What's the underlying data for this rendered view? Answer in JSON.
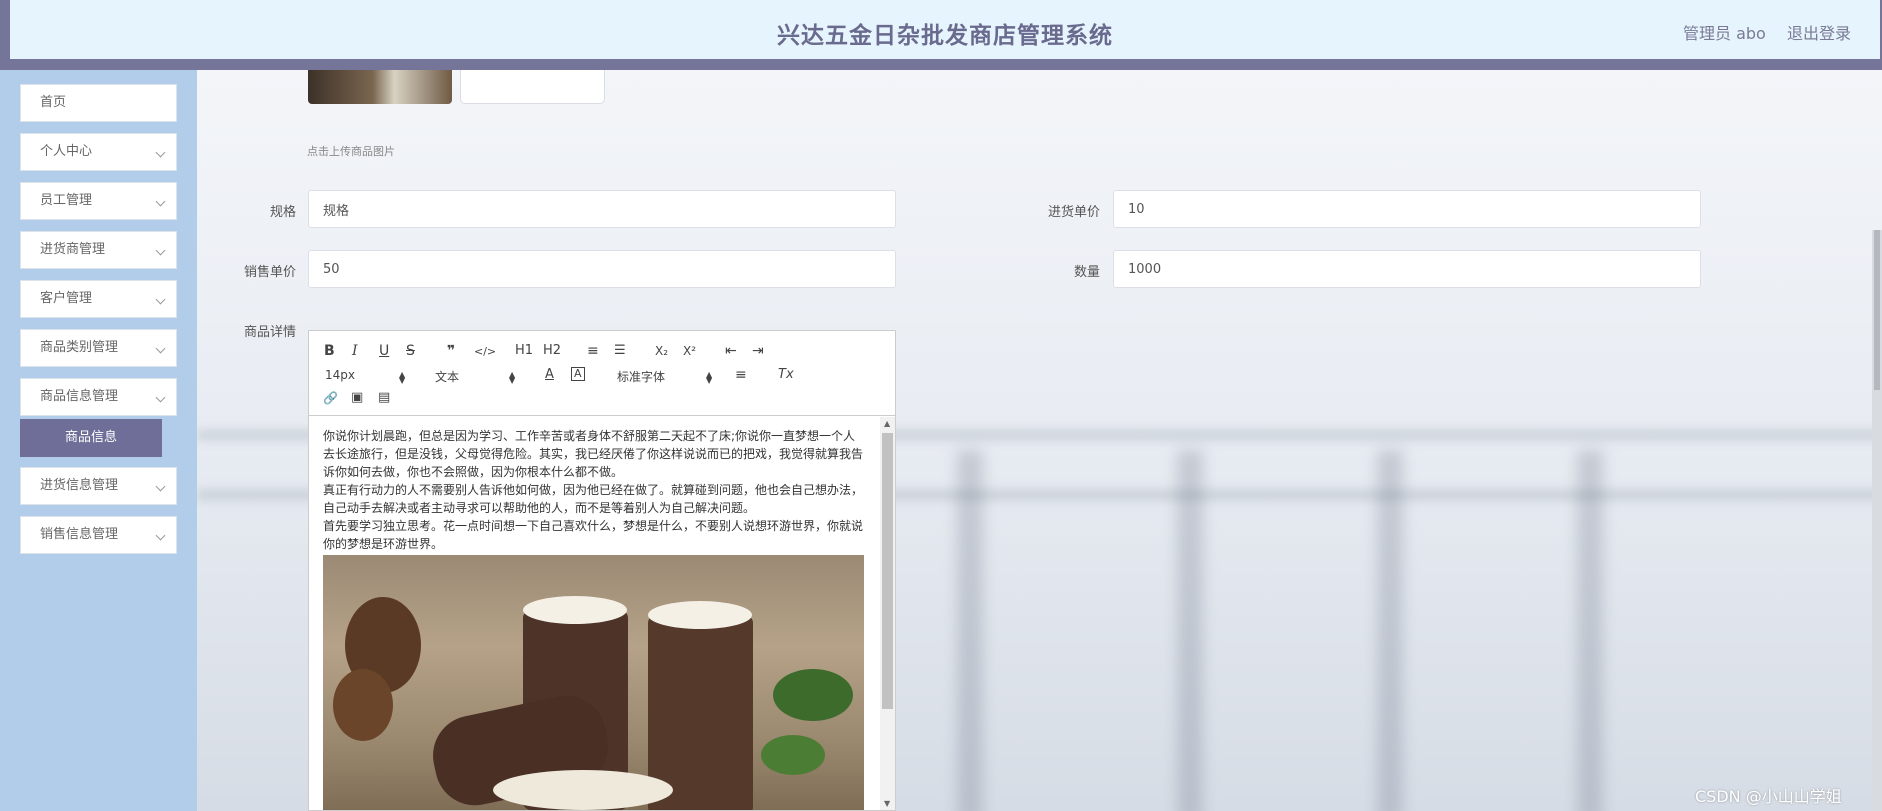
{
  "header": {
    "title": "兴达五金日杂批发商店管理系统",
    "admin": "管理员 abo",
    "logout": "退出登录"
  },
  "sidebar": {
    "items": [
      {
        "label": "首页"
      },
      {
        "label": "个人中心"
      },
      {
        "label": "员工管理"
      },
      {
        "label": "进货商管理"
      },
      {
        "label": "客户管理"
      },
      {
        "label": "商品类别管理"
      },
      {
        "label": "商品信息管理"
      },
      {
        "label": "进货信息管理"
      },
      {
        "label": "销售信息管理"
      }
    ],
    "active_sub": "商品信息"
  },
  "form": {
    "upload_hint": "点击上传商品图片",
    "spec_label": "规格",
    "spec_value": "规格",
    "purchase_price_label": "进货单价",
    "purchase_price_value": "10",
    "sale_price_label": "销售单价",
    "sale_price_value": "50",
    "quantity_label": "数量",
    "quantity_value": "1000",
    "detail_label": "商品详情"
  },
  "editor": {
    "toolbar": {
      "bold": "B",
      "italic": "I",
      "underline": "U",
      "strike": "S",
      "quote": "❞",
      "code": "</>",
      "h1": "H1",
      "h2": "H2",
      "ordered_list": "≡",
      "bullet_list": "☰",
      "subscript": "X₂",
      "superscript": "X²",
      "outdent": "⇤",
      "indent": "⇥",
      "font_size": "14px",
      "text_style": "文本",
      "font_color": "A",
      "bg_color": "A",
      "font_family": "标准字体",
      "align": "≡",
      "clear_format": "Tx",
      "link": "🔗",
      "image": "▣",
      "video": "▤"
    },
    "paragraphs": [
      "你说你计划晨跑，但总是因为学习、工作辛苦或者身体不舒服第二天起不了床;你说你一直梦想一个人去长途旅行，但是没钱，父母觉得危险。其实，我已经厌倦了你这样说说而已的把戏，我觉得就算我告诉你如何去做，你也不会照做，因为你根本什么都不做。",
      "真正有行动力的人不需要别人告诉他如何做，因为他已经在做了。就算碰到问题，他也会自己想办法，自己动手去解决或者主动寻求可以帮助他的人，而不是等着别人为自己解决问题。",
      "首先要学习独立思考。花一点时间想一下自己喜欢什么，梦想是什么，不要别人说想环游世界，你就说你的梦想是环游世界。"
    ]
  },
  "watermark": "CSDN @小山山学姐"
}
